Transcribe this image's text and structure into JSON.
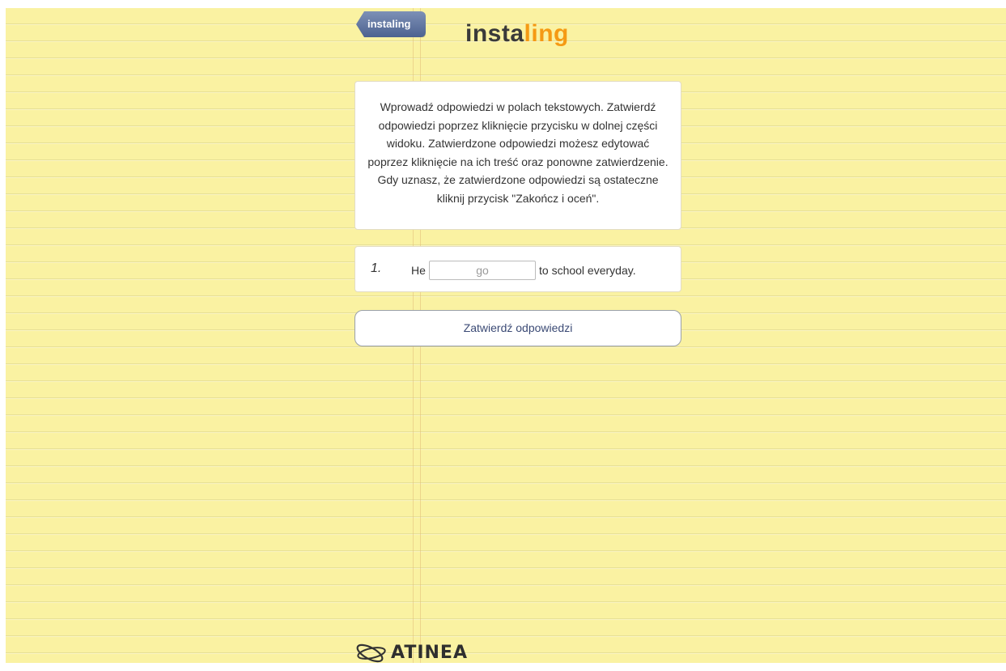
{
  "header": {
    "back_label": "instaling",
    "logo_part1": "insta",
    "logo_part2": "ling"
  },
  "instructions": {
    "text": "Wprowadź odpowiedzi w polach tekstowych. Zatwierdź odpowiedzi poprzez kliknięcie przycisku w dolnej części widoku. Zatwierdzone odpowiedzi możesz edytować poprzez kliknięcie na ich treść oraz ponowne zatwierdzenie. Gdy uznasz, że zatwierdzone odpowiedzi są ostateczne kliknij przycisk \"Zakończ i oceń\"."
  },
  "question": {
    "number": "1.",
    "before": "He",
    "placeholder": "go",
    "value": "",
    "after": "to school everyday."
  },
  "submit_label": "Zatwierdź odpowiedzi",
  "footer": {
    "brand": "ATINEA"
  },
  "colors": {
    "paper": "#faf2a2",
    "back_button": "#5b6f9b",
    "logo_accent": "#f59a14",
    "button_text": "#3b4a75"
  }
}
